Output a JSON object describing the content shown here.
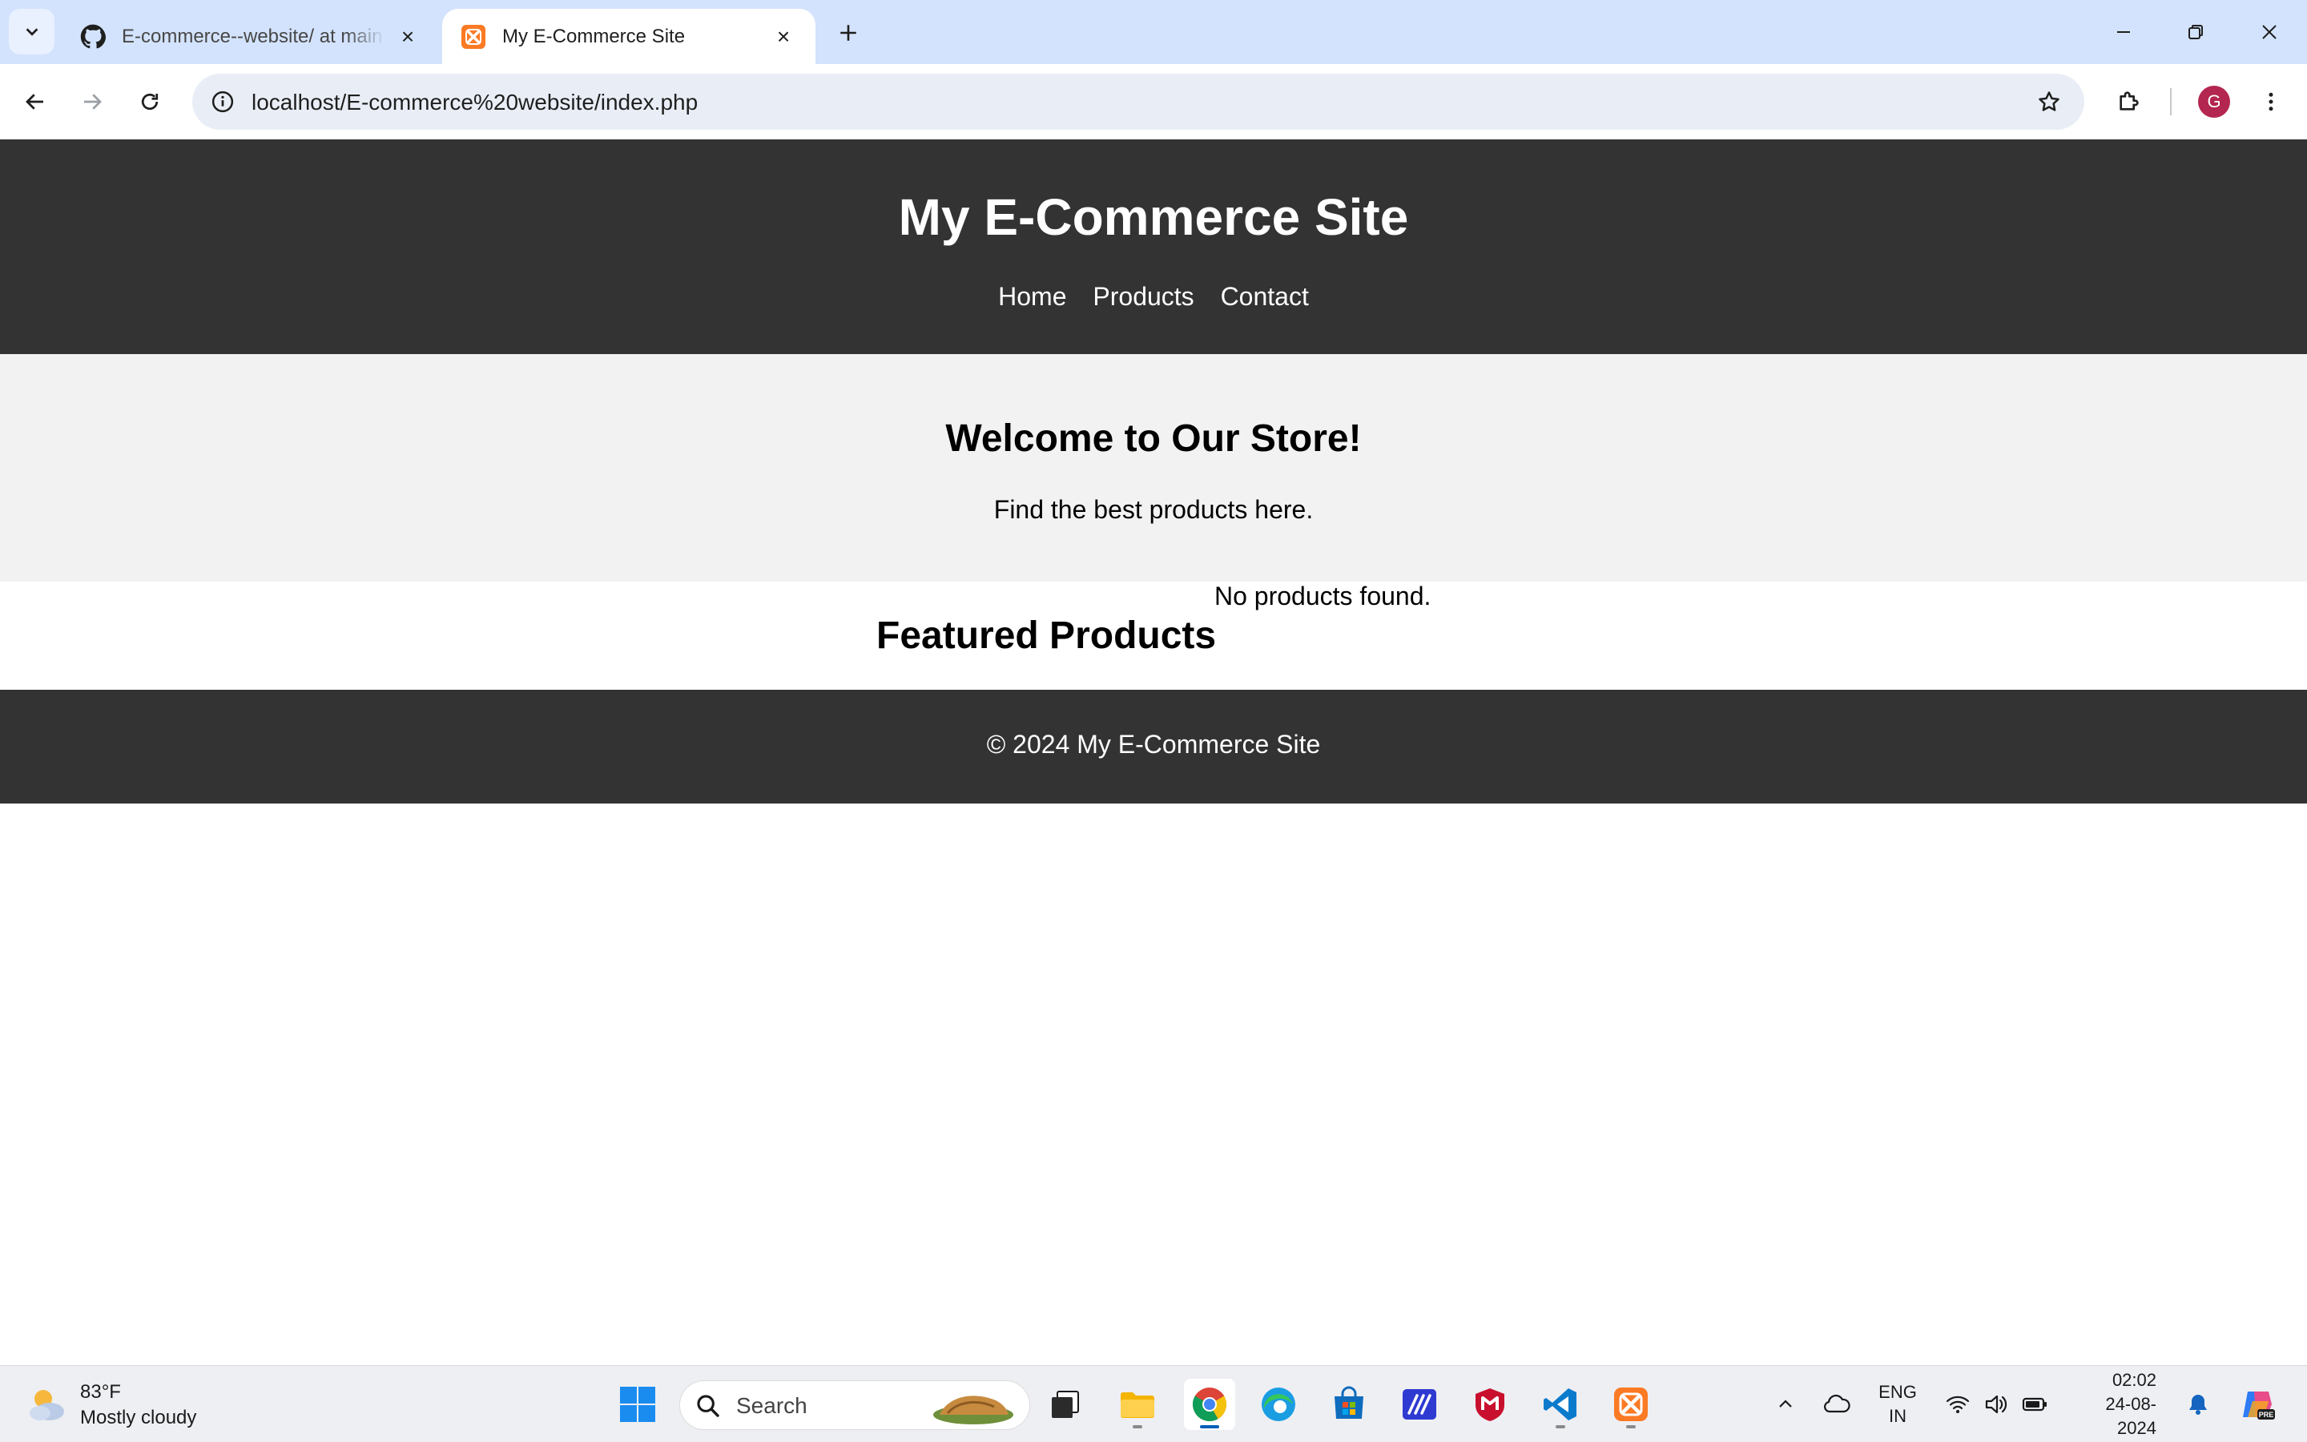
{
  "browser": {
    "tabs": [
      {
        "title": "E-commerce--website/ at main",
        "favicon": "github-icon",
        "active": false
      },
      {
        "title": "My E-Commerce Site",
        "favicon": "xampp-icon",
        "active": true
      }
    ],
    "url": "localhost/E-commerce%20website/index.php",
    "profile_initial": "G"
  },
  "site": {
    "title": "My E-Commerce Site",
    "nav": [
      "Home",
      "Products",
      "Contact"
    ],
    "hero": {
      "heading": "Welcome to Our Store!",
      "subheading": "Find the best products here."
    },
    "featured_title": "Featured Products",
    "empty_message": "No products found.",
    "footer": "© 2024 My E-Commerce Site"
  },
  "taskbar": {
    "weather": {
      "temperature": "83°F",
      "condition": "Mostly cloudy"
    },
    "search_label": "Search",
    "apps": [
      "windows-start-icon",
      "task-view-icon",
      "file-explorer-icon",
      "chrome-icon",
      "edge-icon",
      "microsoft-store-icon",
      "powerautomate-icon",
      "mcafee-icon",
      "vscode-icon",
      "xampp-icon"
    ],
    "language": {
      "line1": "ENG",
      "line2": "IN"
    },
    "time": "02:02",
    "date": "24-08-2024"
  },
  "colors": {
    "site_header_bg": "#333333",
    "hero_bg": "#f2f2f2",
    "tabstrip_bg": "#d3e3fd",
    "omnibox_bg": "#e9eef6",
    "avatar_bg": "#b3264f"
  }
}
